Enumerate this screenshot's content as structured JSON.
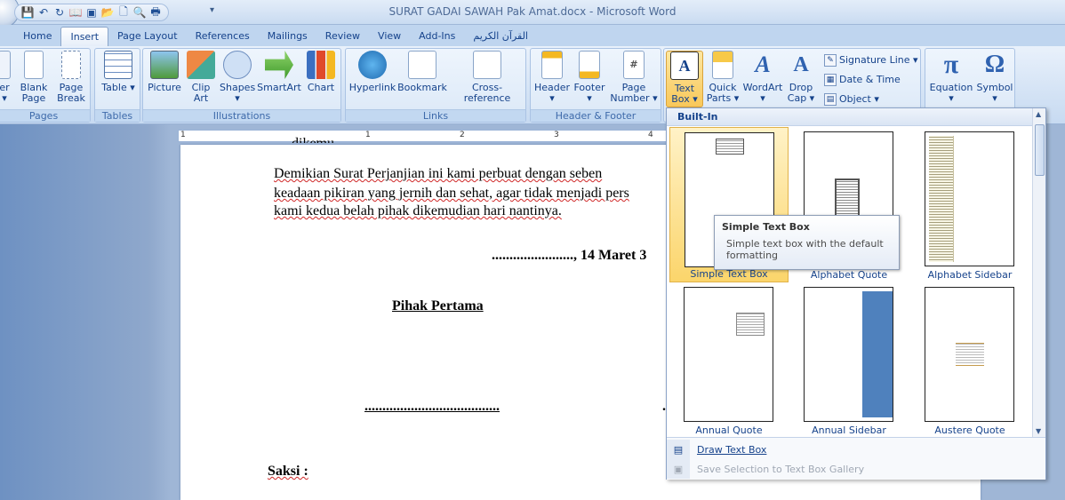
{
  "window": {
    "title": "SURAT GADAI SAWAH Pak Amat.docx - Microsoft Word"
  },
  "quick_access": [
    {
      "name": "save-icon",
      "glyph": "💾"
    },
    {
      "name": "undo-icon",
      "glyph": "↶"
    },
    {
      "name": "redo-icon",
      "glyph": "↻"
    },
    {
      "name": "book-icon",
      "glyph": "📖"
    },
    {
      "name": "image-icon",
      "glyph": "▣"
    },
    {
      "name": "open-folder-icon",
      "glyph": "📂"
    },
    {
      "name": "new-document-icon",
      "glyph": "🗋"
    },
    {
      "name": "print-preview-icon",
      "glyph": "🔍"
    },
    {
      "name": "print-icon",
      "glyph": "🖶"
    }
  ],
  "qat_more": "▾",
  "tabs": [
    "Home",
    "Insert",
    "Page Layout",
    "References",
    "Mailings",
    "Review",
    "View",
    "Add-Ins",
    "القرآن الكريم"
  ],
  "active_tab": "Insert",
  "ribbon": {
    "pages": {
      "label": "Pages",
      "cover_partial": "er",
      "cover_arrow": "▾",
      "blank_page": "Blank Page",
      "page_break": "Page Break"
    },
    "tables": {
      "label": "Tables",
      "table": "Table ▾"
    },
    "illustrations": {
      "label": "Illustrations",
      "picture": "Picture",
      "clip_art": "Clip Art",
      "shapes": "Shapes ▾",
      "smartart": "SmartArt",
      "chart": "Chart"
    },
    "links": {
      "label": "Links",
      "hyperlink": "Hyperlink",
      "bookmark": "Bookmark",
      "cross_reference": "Cross-reference"
    },
    "header_footer": {
      "label": "Header & Footer",
      "header": "Header ▾",
      "footer": "Footer ▾",
      "page_number": "Page Number ▾"
    },
    "text": {
      "text_box": "Text Box ▾",
      "quick_parts": "Quick Parts ▾",
      "wordart": "WordArt ▾",
      "drop_cap": "Drop Cap ▾",
      "signature_line": "Signature Line ▾",
      "date_time": "Date & Time",
      "object": "Object ▾"
    },
    "symbols": {
      "equation": "Equation ▾",
      "symbol": "Symbol ▾"
    }
  },
  "ruler_numbers": [
    "1",
    "1",
    "2",
    "3",
    "4"
  ],
  "document": {
    "top_partial": "dikemu",
    "para_line1": "Demikian Surat Perjanjian ini kami perbuat dengan seben",
    "para_line2": "keadaan pikiran yang jernih dan sehat, agar tidak menjadi pers",
    "para_line3": "kami kedua belah pihak dikemudian hari nantinya.",
    "date_line": "......................., 14 Maret 3",
    "pihak_pertama": "Pihak Pertama",
    "signature_dots": "......................................",
    "sig2_partial": ".",
    "saksi": "Saksi :"
  },
  "gallery": {
    "header": "Built-In",
    "items": [
      "Simple Text Box",
      "Alphabet Quote",
      "Alphabet Sidebar",
      "Annual Quote",
      "Annual Sidebar",
      "Austere Quote"
    ],
    "draw_text_box": "Draw Text Box",
    "save_selection": "Save Selection to Text Box Gallery"
  },
  "tooltip": {
    "title": "Simple Text Box",
    "body": "Simple text box with the default formatting"
  },
  "colors": {
    "ribbon_blue": "#15428b",
    "highlight": "#f9c85a",
    "annual_sidebar_bar": "#4f81bd"
  }
}
